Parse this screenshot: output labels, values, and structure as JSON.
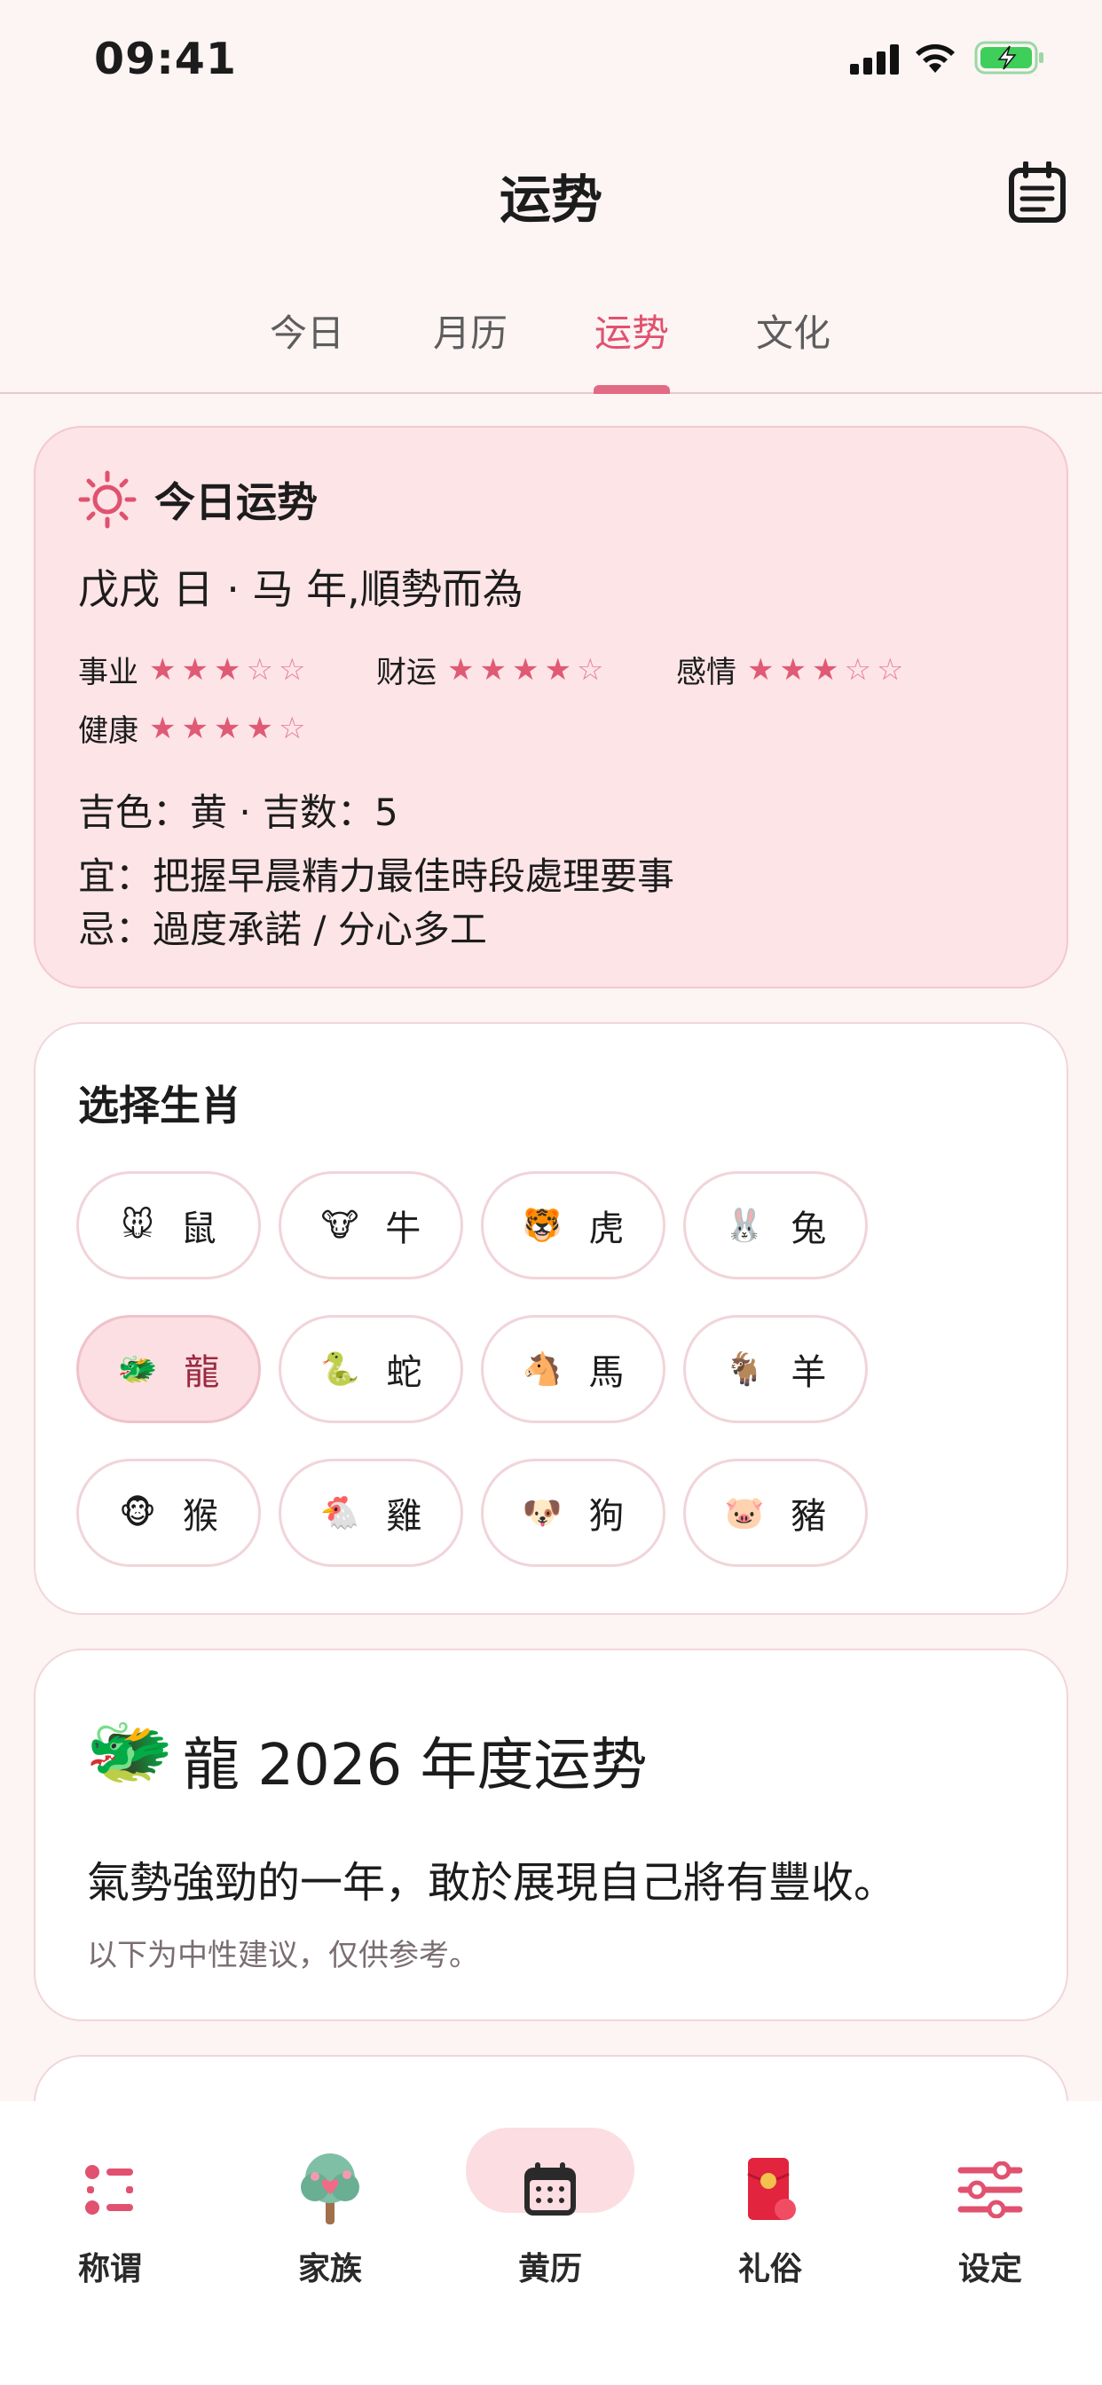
{
  "status_bar": {
    "time": "09:41"
  },
  "header": {
    "title": "运势",
    "calendar_icon": "notes-icon"
  },
  "tabs": [
    {
      "label": "今日",
      "active": false
    },
    {
      "label": "月历",
      "active": false
    },
    {
      "label": "运势",
      "active": true
    },
    {
      "label": "文化",
      "active": false
    }
  ],
  "fortune": {
    "title": "今日运势",
    "subtitle": "戊戌 日 · 马 年,順勢而為",
    "ratings": [
      {
        "label": "事业",
        "stars": 3,
        "max": 5
      },
      {
        "label": "财运",
        "stars": 4,
        "max": 5
      },
      {
        "label": "感情",
        "stars": 3,
        "max": 5
      },
      {
        "label": "健康",
        "stars": 4,
        "max": 5
      }
    ],
    "lucky": "吉色：黄 · 吉数：5",
    "do": "宜：把握早晨精力最佳時段處理要事",
    "avoid": "忌：過度承諾 / 分心多工"
  },
  "zodiac": {
    "title": "选择生肖",
    "items": [
      {
        "emoji": "🐭",
        "label": "鼠"
      },
      {
        "emoji": "🐮",
        "label": "牛"
      },
      {
        "emoji": "🐯",
        "label": "虎"
      },
      {
        "emoji": "🐰",
        "label": "兔"
      },
      {
        "emoji": "🐲",
        "label": "龍",
        "selected": true
      },
      {
        "emoji": "🐍",
        "label": "蛇"
      },
      {
        "emoji": "🐴",
        "label": "馬"
      },
      {
        "emoji": "🐐",
        "label": "羊"
      },
      {
        "emoji": "🐵",
        "label": "猴"
      },
      {
        "emoji": "🐔",
        "label": "雞"
      },
      {
        "emoji": "🐶",
        "label": "狗"
      },
      {
        "emoji": "🐷",
        "label": "豬"
      }
    ]
  },
  "yearly": {
    "emoji": "🐲",
    "title": "龍 2026 年度运势",
    "text": "氣勢強勁的一年，敢於展現自己將有豐收。",
    "note": "以下为中性建议，仅供参考。"
  },
  "nav": [
    {
      "label": "称谓",
      "icon": "grid-nodes-icon"
    },
    {
      "label": "家族",
      "icon": "family-tree-icon"
    },
    {
      "label": "黄历",
      "icon": "calendar-icon",
      "active": true
    },
    {
      "label": "礼俗",
      "icon": "red-envelope-icon"
    },
    {
      "label": "设定",
      "icon": "sliders-icon"
    }
  ],
  "colors": {
    "accent": "#e0526f",
    "card_pink": "#fde4e7",
    "background": "#fdf4f4"
  }
}
